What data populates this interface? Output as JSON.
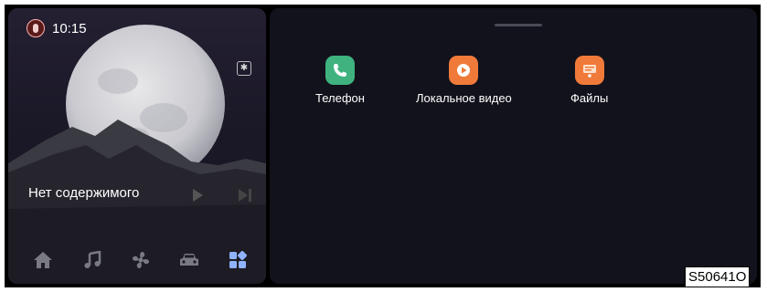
{
  "status": {
    "time": "10:15"
  },
  "media": {
    "now_playing": "Нет содержимого"
  },
  "dock": {
    "items": [
      "home-icon",
      "music-icon",
      "fan-icon",
      "car-icon",
      "apps-icon"
    ],
    "active_color": "#8fb3ff"
  },
  "apps": [
    {
      "label": "Телефон",
      "icon": "phone-icon",
      "color": "#3fb27f"
    },
    {
      "label": "Локальное видео",
      "icon": "video-icon",
      "color": "#f07a3a"
    },
    {
      "label": "Файлы",
      "icon": "files-icon",
      "color": "#f07a3a"
    }
  ],
  "figure_code": "S50641O"
}
